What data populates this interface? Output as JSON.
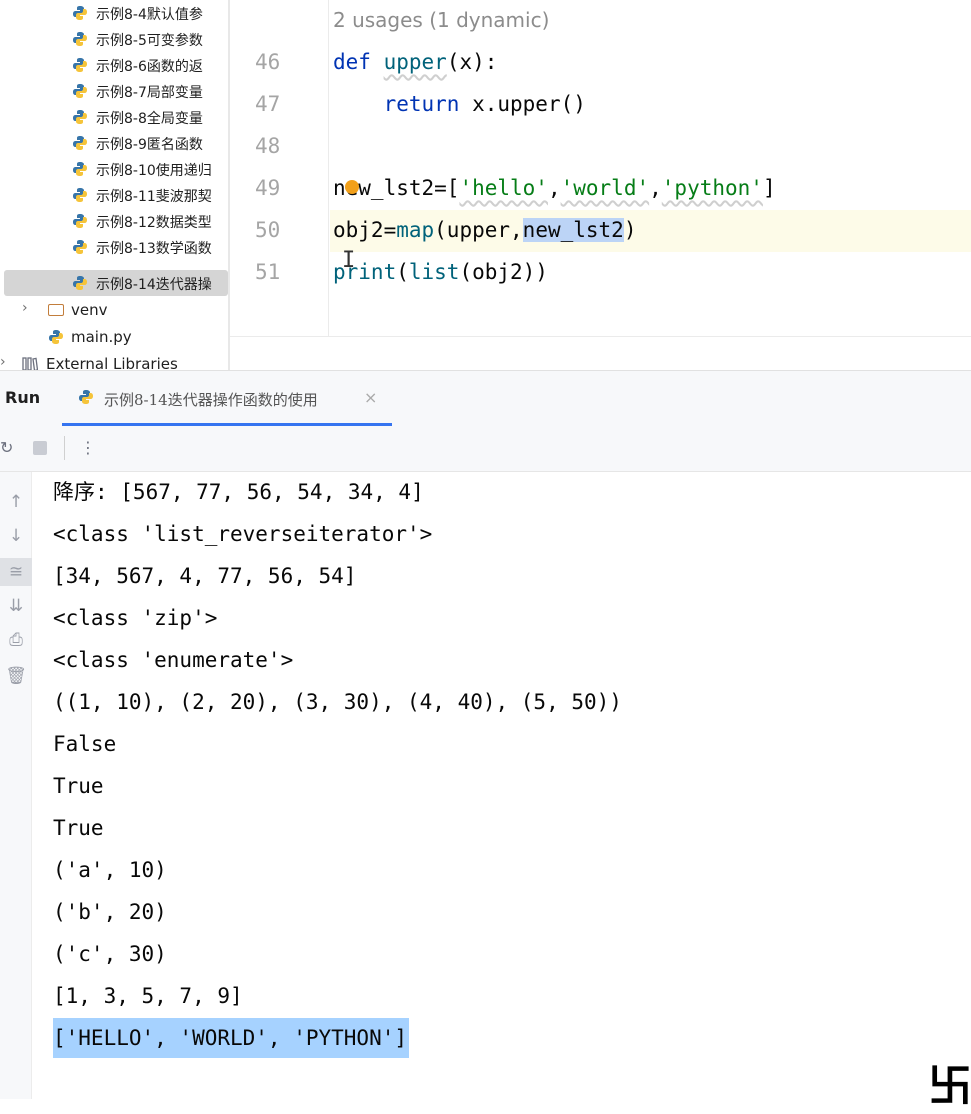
{
  "project_tree": {
    "items": [
      {
        "label": "示例8-4默认值参"
      },
      {
        "label": "示例8-5可变参数"
      },
      {
        "label": "示例8-6函数的返"
      },
      {
        "label": "示例8-7局部变量"
      },
      {
        "label": "示例8-8全局变量"
      },
      {
        "label": "示例8-9匿名函数"
      },
      {
        "label": "示例8-10使用递归"
      },
      {
        "label": "示例8-11斐波那契"
      },
      {
        "label": "示例8-12数据类型"
      },
      {
        "label": "示例8-13数学函数"
      },
      {
        "label": "示例8-14迭代器操"
      }
    ],
    "venv": "venv",
    "main": "main.py",
    "external": "External Libraries"
  },
  "editor": {
    "usages_hint": "2 usages (1 dynamic)",
    "line_numbers": [
      "46",
      "47",
      "48",
      "49",
      "50",
      "51"
    ]
  },
  "run_panel": {
    "title": "Run",
    "tab_label": "示例8-14迭代器操作函数的使用",
    "close_glyph": "×"
  },
  "console": {
    "lines": [
      "降序: [567, 77, 56, 54, 34, 4]",
      "<class 'list_reverseiterator'>",
      "[34, 567, 4, 77, 56, 54]",
      "<class 'zip'>",
      "<class 'enumerate'>",
      "((1, 10), (2, 20), (3, 30), (4, 40), (5, 50))",
      "False",
      "True",
      "True",
      "('a', 10)",
      "('b', 20)",
      "('c', 30)",
      "[1, 3, 5, 7, 9]",
      "['HELLO', 'WORLD', 'PYTHON']"
    ]
  },
  "icons": {
    "python": "python-file-icon",
    "folder": "folder-icon",
    "library": "library-icon",
    "rerun": "rerun-icon",
    "stop": "stop-icon",
    "more": "more-icon",
    "up": "arrow-up-icon",
    "down": "arrow-down-icon",
    "wrap": "soft-wrap-icon",
    "scroll": "scroll-to-end-icon",
    "print": "print-icon",
    "trash": "trash-icon"
  },
  "colors": {
    "keyword": "#0033b3",
    "function": "#00627a",
    "string": "#067d17",
    "selection": "#bcd4f6",
    "output_highlight": "#a6d2ff",
    "tab_underline": "#3574f0"
  }
}
